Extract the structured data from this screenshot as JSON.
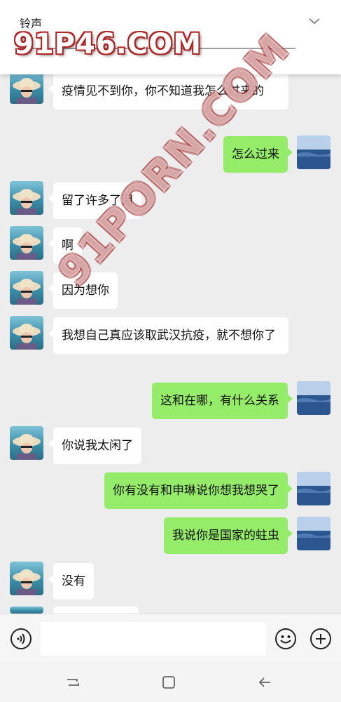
{
  "header": {
    "ringtone_label": "铃声"
  },
  "watermarks": [
    "91P46.COM",
    "91PORN.COM"
  ],
  "icons": {
    "collapse": "chevron-down-icon",
    "voice": "voice-icon",
    "emoji": "emoji-icon",
    "plus": "plus-icon",
    "nav_recent": "recent-apps-icon",
    "nav_home": "home-icon",
    "nav_back": "back-icon"
  },
  "colors": {
    "chat_background": "#ededed",
    "incoming_bubble": "#ffffff",
    "outgoing_bubble": "#95ec69"
  },
  "messages": [
    {
      "side": "left",
      "text": "疫情见不到你，你不知道我怎么过来的"
    },
    {
      "side": "right",
      "text": "怎么过来"
    },
    {
      "side": "left",
      "text": "留了许多了泪"
    },
    {
      "side": "left",
      "text": "啊"
    },
    {
      "side": "left",
      "text": "因为想你"
    },
    {
      "side": "left",
      "text": "我想自己真应该取武汉抗疫，就不想你了"
    },
    {
      "side": "right",
      "text": "这和在哪，有什么关系"
    },
    {
      "side": "left",
      "text": "你说我太闲了"
    },
    {
      "side": "right",
      "text": "你有没有和申琳说你想我想哭了"
    },
    {
      "side": "right",
      "text": "我说你是国家的蛀虫"
    },
    {
      "side": "left",
      "text": "没有"
    }
  ],
  "input": {
    "value": "",
    "placeholder": ""
  }
}
